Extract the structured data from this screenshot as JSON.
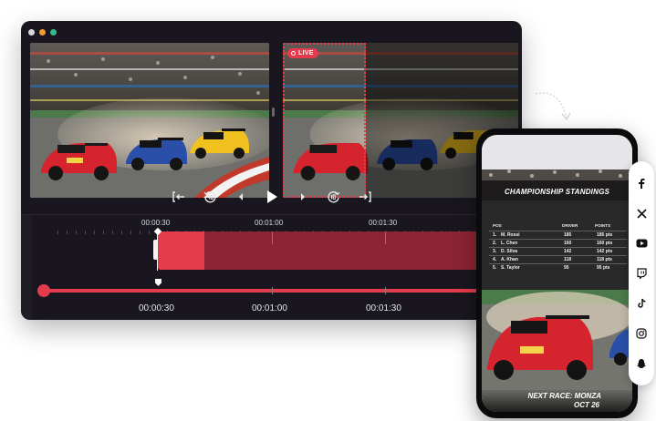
{
  "editor": {
    "live_badge": "LIVE",
    "timeline_top": [
      {
        "label": "00:00:30"
      },
      {
        "label": "00:01:00"
      },
      {
        "label": "00:01:30"
      }
    ],
    "timeline_bottom": [
      {
        "label": "00:00:30"
      },
      {
        "label": "00:01:00"
      },
      {
        "label": "00:01:30"
      }
    ],
    "controls": {
      "mark_in_icon": "bracket-left-arrow-icon",
      "rewind_icon": "rewind-10-icon",
      "prev_frame_icon": "chevron-left-icon",
      "play_icon": "play-icon",
      "next_frame_icon": "chevron-right-icon",
      "forward_icon": "forward-10-icon",
      "mark_out_icon": "bracket-right-arrow-icon"
    },
    "colors": {
      "accent": "#e43c4c",
      "clip": "#8b2432",
      "window": "#19161f"
    }
  },
  "phone": {
    "standings_title": "CHAMPIONSHIP STANDINGS",
    "columns": {
      "pos": "POS",
      "driver": "DRIVER",
      "points": "POINTS"
    },
    "rows": [
      {
        "pos": "1.",
        "name": "M. Rossi",
        "driver": "185",
        "points": "185 pts"
      },
      {
        "pos": "2.",
        "name": "L. Chen",
        "driver": "160",
        "points": "160 pts"
      },
      {
        "pos": "3.",
        "name": "D. Silva",
        "driver": "142",
        "points": "142 pts"
      },
      {
        "pos": "4.",
        "name": "A. Khan",
        "driver": "118",
        "points": "118 pts"
      },
      {
        "pos": "5.",
        "name": "S. Taylor",
        "driver": "95",
        "points": "95 pts"
      }
    ],
    "next_race_line1": "NEXT RACE: MONZA",
    "next_race_line2": "OCT 26"
  },
  "social": [
    "facebook-icon",
    "x-icon",
    "youtube-icon",
    "twitch-icon",
    "tiktok-icon",
    "instagram-icon",
    "snapchat-icon"
  ]
}
